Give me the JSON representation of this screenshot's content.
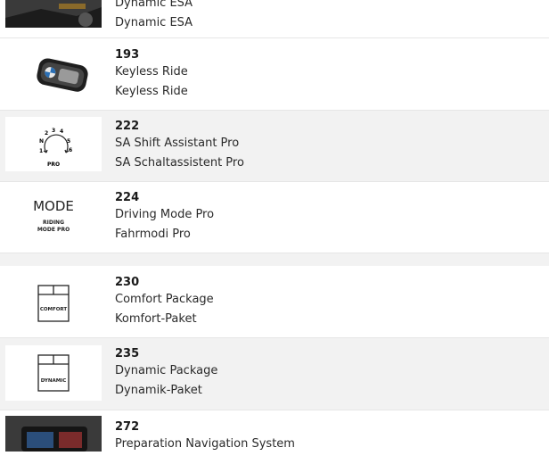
{
  "items": [
    {
      "lines": [
        "Dynamic ESA",
        "Dynamic ESA"
      ]
    },
    {
      "code": "193",
      "lines": [
        "Keyless Ride",
        "Keyless Ride"
      ]
    },
    {
      "code": "222",
      "lines": [
        "SA Shift Assistant Pro",
        "SA Schaltassistent Pro"
      ],
      "icon_label": "PRO",
      "gears": [
        "N",
        "1",
        "2",
        "3",
        "4",
        "5",
        "6"
      ]
    },
    {
      "code": "224",
      "lines": [
        "Driving Mode Pro",
        "Fahrmodi Pro"
      ],
      "icon_title": "MODE",
      "icon_sub1": "RIDING",
      "icon_sub2": "MODE PRO"
    },
    {
      "code": "230",
      "lines": [
        "Comfort Package",
        "Komfort-Paket"
      ],
      "icon_label": "COMFORT"
    },
    {
      "code": "235",
      "lines": [
        "Dynamic Package",
        "Dynamik-Paket"
      ],
      "icon_label": "DYNAMIC"
    },
    {
      "code": "272",
      "lines": [
        "Preparation Navigation System"
      ]
    }
  ]
}
